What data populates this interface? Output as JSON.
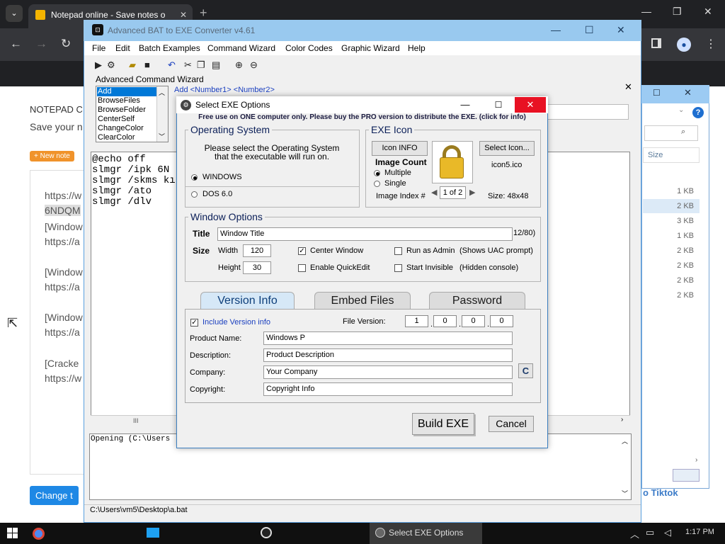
{
  "browser": {
    "tab_title": "Notepad online - Save notes o",
    "tab_close": "✕",
    "new_tab": "+",
    "menu_glyph": "⌄"
  },
  "notepad": {
    "heading": "NOTEPAD C",
    "subheading": "Save your n",
    "badge": "+ New note",
    "lines": [
      "https://w",
      "6NDQM",
      "[Window",
      "https://a",
      "[Window",
      "https://a",
      "[Window",
      "https://a",
      "[Cracke",
      "https://w"
    ],
    "change_button": "Change t"
  },
  "explorer": {
    "size_header": "Size",
    "sizes": [
      "1 KB",
      "2 KB",
      "3 KB",
      "1 KB",
      "2 KB",
      "2 KB",
      "2 KB",
      "2 KB"
    ],
    "tiktok_text": "o Tiktok",
    "help_icon": "?"
  },
  "bat": {
    "title": "Advanced BAT to EXE Converter v4.61",
    "menu": [
      "File",
      "Edit",
      "Batch Examples",
      "Command Wizard",
      "Color Codes",
      "Graphic Wizard",
      "Help"
    ],
    "wizard_label": "Advanced Command Wizard",
    "commands": [
      "Add",
      "BrowseFiles",
      "BrowseFolder",
      "CenterSelf",
      "ChangeColor",
      "ClearColor"
    ],
    "add_syntax": "Add  <Number1> <Number2>",
    "code_lines": [
      "@echo off",
      "slmgr /ipk 6N",
      "slmgr /skms kı",
      "slmgr /ato",
      "slmgr /dlv"
    ],
    "output_text": "Opening (C:\\Users",
    "status_path": "C:\\Users\\vm5\\Desktop\\a.bat"
  },
  "dialog": {
    "title": "Select EXE Options",
    "notice": "Free use on ONE computer only. Please buy the PRO version to distribute the EXE. (click for info)",
    "os": {
      "title": "Operating System",
      "desc_line1": "Please select the Operating System",
      "desc_line2": "that the executable will run on.",
      "windows": "WINDOWS",
      "dos": "DOS 6.0",
      "selected": "WINDOWS"
    },
    "icon": {
      "title": "EXE Icon",
      "info_button": "Icon INFO",
      "image_count": "Image Count",
      "multiple": "Multiple",
      "single": "Single",
      "selected": "Multiple",
      "image_index": "Image Index #",
      "pager": "1 of 2",
      "select_button": "Select Icon...",
      "filename": "icon5.ico",
      "size": "Size: 48x48"
    },
    "window_options": {
      "title": "Window Options",
      "title_label": "Title",
      "title_value": "Window Title",
      "title_count": "12/80)",
      "size_label": "Size",
      "width_label": "Width",
      "width_value": "120",
      "height_label": "Height",
      "height_value": "30",
      "center_window": "Center Window",
      "center_window_checked": true,
      "quick_edit": "Enable QuickEdit",
      "run_admin": "Run as Admin",
      "run_admin_note": "(Shows UAC prompt)",
      "start_invisible": "Start Invisible",
      "start_invisible_note": "(Hidden console)"
    },
    "tabs": [
      "Version Info",
      "Embed Files",
      "Password"
    ],
    "version": {
      "include_label": "Include Version info",
      "file_version_label": "File Version:",
      "file_version": [
        "1",
        "0",
        "0",
        "0"
      ],
      "product_name_label": "Product Name:",
      "product_name": "Windows P",
      "description_label": "Description:",
      "description": "Product Description",
      "company_label": "Company:",
      "company": "Your Company",
      "copyright_label": "Copyright:",
      "copyright": "Copyright Info",
      "c_button": "C"
    },
    "build_button": "Build EXE",
    "cancel_button": "Cancel"
  },
  "taskbar": {
    "active_window": "Select EXE Options",
    "clock": "1:17 PM"
  },
  "colors": {
    "accent_blue": "#0078d7",
    "close_red": "#e81123",
    "bat_titlebar": "#99c9ef"
  }
}
